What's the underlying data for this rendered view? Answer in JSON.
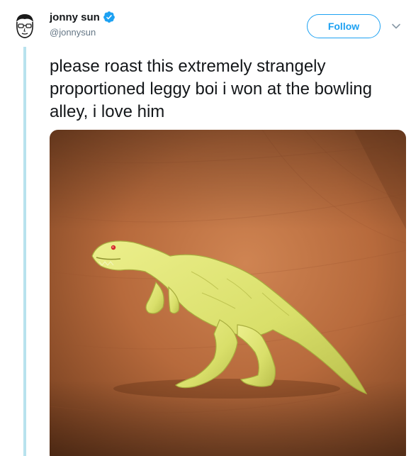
{
  "user": {
    "name": "jonny sun",
    "handle": "@jonnysun",
    "verified": true
  },
  "follow_label": "Follow",
  "tweet": {
    "text": "please roast this extremely strangely proportioned leggy boi i won at the bowling alley, i love him"
  },
  "colors": {
    "accent": "#1da1f2",
    "thread_line": "#b8e2ee",
    "text": "#14171a",
    "secondary_text": "#657786"
  },
  "icons": {
    "verified": "verified-badge-icon",
    "more": "chevron-down-icon"
  }
}
